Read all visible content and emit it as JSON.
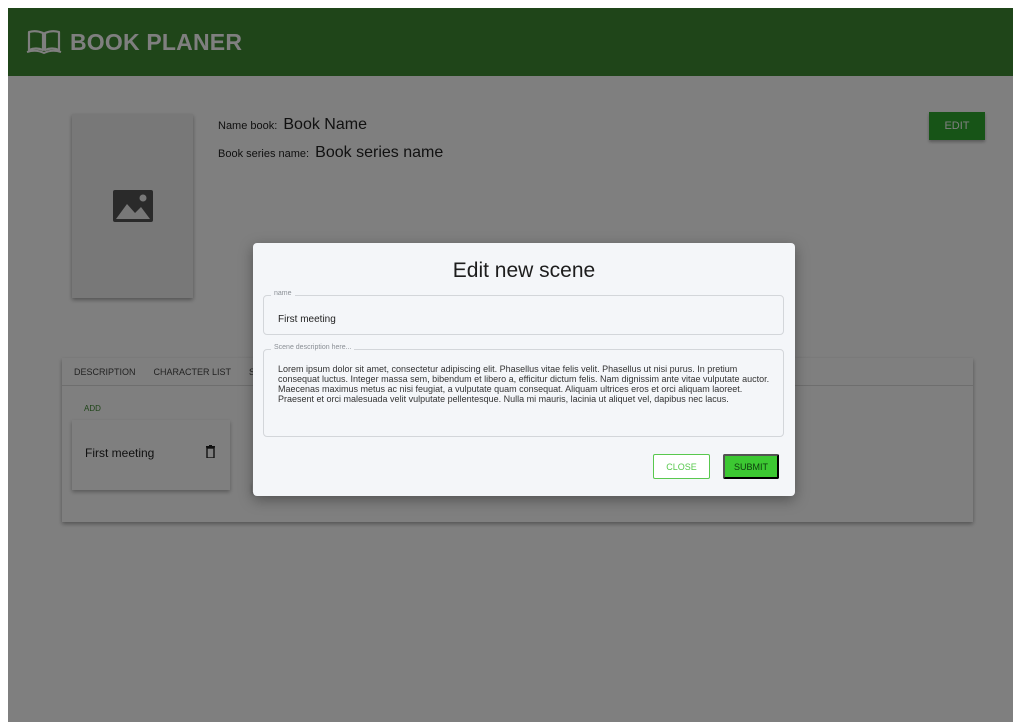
{
  "app": {
    "title": "BOOK PLANER",
    "brand_color": "#3f8a32",
    "logo_icon": "open-book-icon"
  },
  "book": {
    "name_label": "Name book:",
    "name_value": "Book Name",
    "series_label": "Book series name:",
    "series_value": "Book series name",
    "cover_icon": "image-placeholder-icon",
    "edit_label": "EDIT"
  },
  "tabs": [
    "DESCRIPTION",
    "CHARACTER LIST",
    "S"
  ],
  "scenes": {
    "add_label": "ADD",
    "items": [
      {
        "name": "First meeting",
        "delete_icon": "trash-icon"
      }
    ]
  },
  "dialog": {
    "title": "Edit new scene",
    "name_field": {
      "label": "name",
      "value": "First meeting"
    },
    "description_field": {
      "label": "Scene description here...",
      "value": "Lorem ipsum dolor sit amet, consectetur adipiscing elit. Phasellus vitae felis velit. Phasellus ut nisi purus. In pretium consequat luctus. Integer massa sem, bibendum et libero a, efficitur dictum felis. Nam dignissim ante vitae vulputate auctor. Maecenas maximus metus ac nisi feugiat, a vulputate quam consequat. Aliquam ultrices eros et orci aliquam laoreet. Praesent et orci malesuada velit vulputate pellentesque. Nulla mi mauris, lacinia ut aliquet vel, dapibus nec lacus."
    },
    "close_label": "CLOSE",
    "submit_label": "SUBMIT",
    "accent_color": "#3cc832"
  }
}
